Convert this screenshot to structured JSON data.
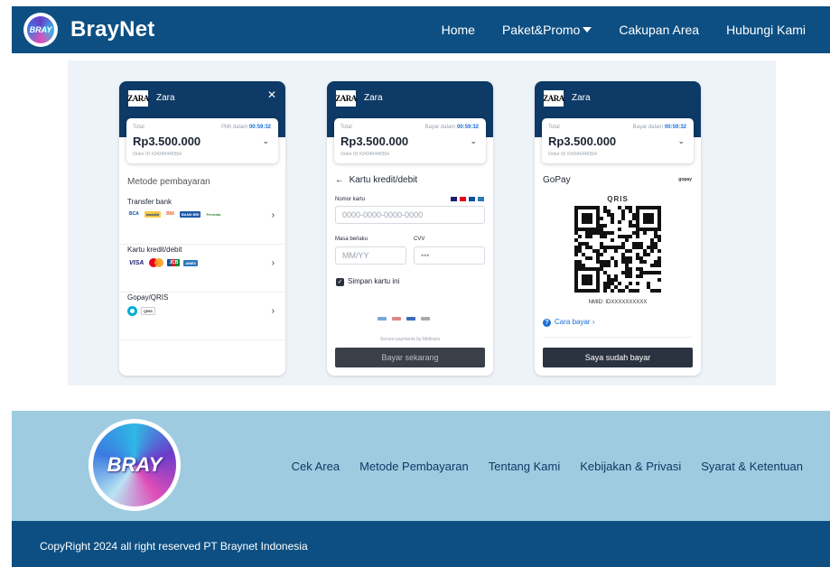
{
  "brand": {
    "name": "BrayNet",
    "logo_text": "BRAY"
  },
  "nav": {
    "home": "Home",
    "paket": "Paket&Promo",
    "cakupan": "Cakupan Area",
    "hubungi": "Hubungi Kami"
  },
  "common": {
    "merchant": "Zara",
    "zara_logo": "ZARA",
    "total_label": "Total",
    "amount": "Rp3.500.000",
    "order_id": "Order ID #34345445554",
    "timer": "00:59:32"
  },
  "card1": {
    "timer_label": "Pilih dalam",
    "section_title": "Metode pembayaran",
    "methods": [
      {
        "title": "Transfer bank",
        "logos": [
          "BCA",
          "mandiri",
          "BNI",
          "BANK BRI",
          "Permata"
        ]
      },
      {
        "title": "Kartu kredit/debit",
        "logos": [
          "VISA",
          "MC",
          "JCB",
          "AMEX"
        ]
      },
      {
        "title": "Gopay/QRIS",
        "logos": [
          "gopay",
          "QRIS"
        ]
      }
    ]
  },
  "card2": {
    "timer_label": "Bayar dalam",
    "title": "Kartu kredit/debit",
    "card_number_label": "Nomor kartu",
    "card_number_placeholder": "0000-0000-0000-0000",
    "expiry_label": "Masa berlaku",
    "expiry_placeholder": "MM/YY",
    "cvv_label": "CVV",
    "cvv_placeholder": "•••",
    "save_card_label": "Simpan kartu ini",
    "save_card_checked": true,
    "secure_text": "Secure payments by Midtrans",
    "pay_button": "Bayar sekarang"
  },
  "card3": {
    "timer_label": "Bayar dalam",
    "title": "GoPay",
    "gopay_logo": "gopay",
    "qris_label": "QRIS",
    "nmid": "NMID: IDXXXXXXXXXX",
    "how_to_pay": "Cara bayar",
    "paid_button": "Saya sudah bayar"
  },
  "footer": {
    "logo_text": "BRAY",
    "links": [
      "Cek Area",
      "Metode Pembayaran",
      "Tentang Kami",
      "Kebijakan & Privasi",
      "Syarat & Ketentuan"
    ],
    "copyright": "CopyRight 2024 all right reserved PT Braynet Indonesia"
  },
  "colors": {
    "primary": "#0d4f82",
    "card_header": "#0d3a66",
    "footer_bg": "#9ecbe0",
    "link_blue": "#1a6fd6",
    "button_dark": "#3a3f48"
  }
}
